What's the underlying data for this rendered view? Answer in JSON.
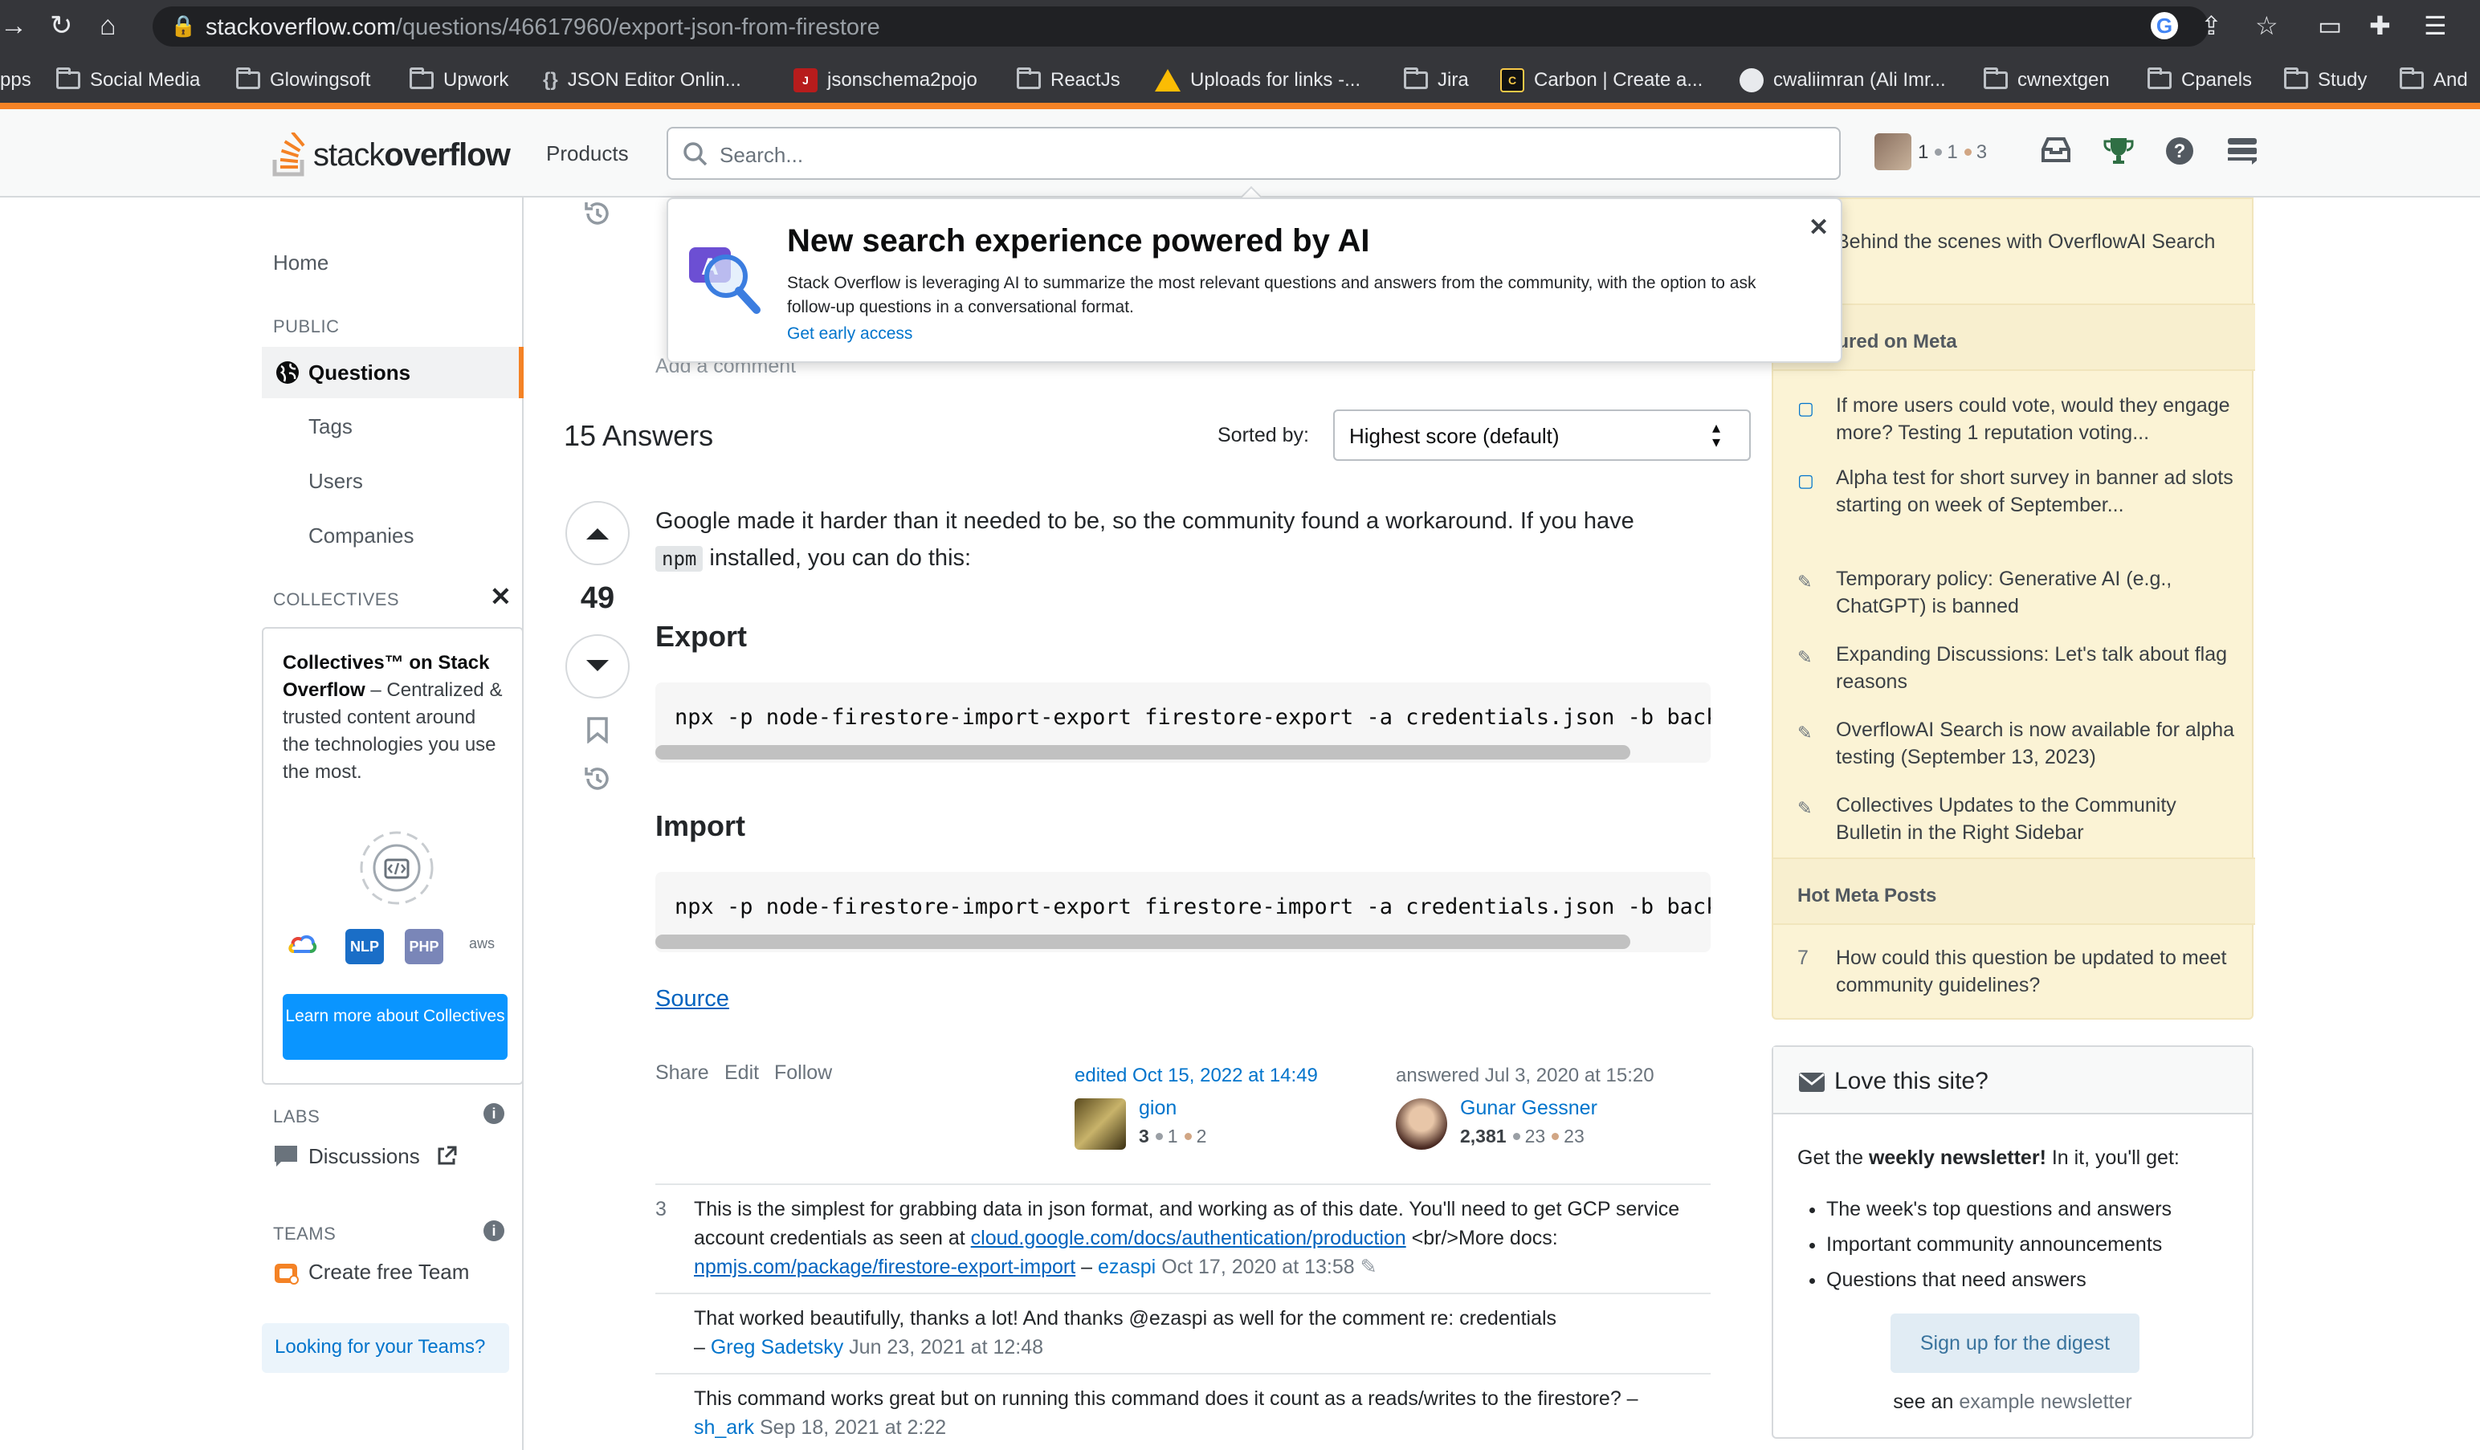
{
  "browser": {
    "url_host": "stackoverflow.com",
    "url_path": "/questions/46617960/export-json-from-firestore",
    "bookmarks": [
      {
        "label": "pps",
        "kind": "text"
      },
      {
        "label": "Social Media",
        "kind": "folder"
      },
      {
        "label": "Glowingsoft",
        "kind": "folder"
      },
      {
        "label": "Upwork",
        "kind": "folder"
      },
      {
        "label": "JSON Editor Onlin...",
        "kind": "braces"
      },
      {
        "label": "jsonschema2pojo",
        "kind": "json"
      },
      {
        "label": "ReactJs",
        "kind": "folder"
      },
      {
        "label": "Uploads for links -...",
        "kind": "drive"
      },
      {
        "label": "Jira",
        "kind": "folder"
      },
      {
        "label": "Carbon | Create a...",
        "kind": "carbon"
      },
      {
        "label": "cwaliimran (Ali Imr...",
        "kind": "github"
      },
      {
        "label": "cwnextgen",
        "kind": "folder"
      },
      {
        "label": "Cpanels",
        "kind": "folder"
      },
      {
        "label": "Study",
        "kind": "folder"
      },
      {
        "label": "And",
        "kind": "folder"
      }
    ]
  },
  "header": {
    "logo_light": "stack",
    "logo_bold": "overflow",
    "products": "Products",
    "search_placeholder": "Search...",
    "rep": "1",
    "silver": "1",
    "bronze": "3",
    "colors": {
      "silver": "#9a9fa5",
      "bronze": "#d1a684",
      "accent": "#f48225"
    }
  },
  "popup": {
    "title": "New search experience powered by AI",
    "body": "Stack Overflow is leveraging AI to summarize the most relevant questions and answers from the community, with the option to ask follow-up questions in a conversational format.",
    "link": "Get early access"
  },
  "leftnav": {
    "home": "Home",
    "public": "PUBLIC",
    "questions": "Questions",
    "tags": "Tags",
    "users": "Users",
    "companies": "Companies",
    "collectives": "COLLECTIVES",
    "collectives_bold": "Collectives™ on Stack Overflow",
    "collectives_desc": " – Centralized & trusted content around the technologies you use the most.",
    "collective_badges": [
      "NLP",
      "PHP",
      "aws"
    ],
    "learn_more": "Learn more about Collectives",
    "labs": "LABS",
    "discussions": "Discussions",
    "teams": "TEAMS",
    "create_team": "Create free Team",
    "looking": "Looking for your Teams?"
  },
  "main": {
    "add_comment": "Add a comment",
    "answers_count": "15 Answers",
    "sorted_by": "Sorted by:",
    "sort_value": "Highest score (default)",
    "answer": {
      "score": "49",
      "text_1": "Google made it harder than it needed to be, so the community found a workaround. If you have",
      "code_inline": "npm",
      "text_2": "installed, you can do this:",
      "export_heading": "Export",
      "export_code": "npx -p node-firestore-import-export firestore-export -a credentials.json -b backup",
      "import_heading": "Import",
      "import_code": "npx -p node-firestore-import-export firestore-import -a credentials.json -b backup",
      "source": "Source",
      "share": "Share",
      "edit": "Edit",
      "follow": "Follow",
      "edited": "edited Oct 15, 2022 at 14:49",
      "editor": {
        "name": "gion",
        "rep": "3",
        "silver": "1",
        "bronze": "2"
      },
      "answered": "answered Jul 3, 2020 at 15:20",
      "author": {
        "name": "Gunar Gessner",
        "rep": "2,381",
        "silver": "23",
        "bronze": "23"
      }
    },
    "comments": [
      {
        "score": "3",
        "text_a": "This is the simplest for grabbing data in json format, and working as of this date. You'll need to get GCP service account credentials as seen at ",
        "link_a": "cloud.google.com/docs/authentication/production",
        "text_b": " <br/>More docs: ",
        "link_b": "npmjs.com/package/firestore-export-import",
        "sep": " – ",
        "user": "ezaspi",
        "date": "Oct 17, 2020 at 13:58"
      },
      {
        "text": "That worked beautifully, thanks a lot! And thanks @ezaspi as well for the comment re: credentials",
        "sep": "– ",
        "user": "Greg Sadetsky",
        "date": "Jun 23, 2021 at 12:48"
      },
      {
        "text": "This command works great but on running this command does it count as a reads/writes to the firestore?",
        "sep": " – ",
        "user": "sh_ark",
        "date": "Sep 18, 2021 at 2:22"
      }
    ]
  },
  "rightbar": {
    "blog_item": "Behind the scenes with OverflowAI Search",
    "featured_head": "Featured on Meta",
    "featured": [
      {
        "icon": "speech-icon",
        "text": "If more users could vote, would they engage more? Testing 1 reputation voting..."
      },
      {
        "icon": "speech-icon",
        "text": "Alpha test for short survey in banner ad slots starting on week of September..."
      },
      {
        "icon": "pencil-icon",
        "text": "Temporary policy: Generative AI (e.g., ChatGPT) is banned"
      },
      {
        "icon": "pencil-icon",
        "text": "Expanding Discussions: Let's talk about flag reasons"
      },
      {
        "icon": "pencil-icon",
        "text": "OverflowAI Search is now available for alpha testing (September 13, 2023)"
      },
      {
        "icon": "pencil-icon",
        "text": "Collectives Updates to the Community Bulletin in the Right Sidebar"
      }
    ],
    "hot_head": "Hot Meta Posts",
    "hot": [
      {
        "count": "7",
        "text": "How could this question be updated to meet community guidelines?"
      }
    ],
    "love_head": "Love this site?",
    "love_intro_a": "Get the ",
    "love_intro_bold": "weekly newsletter!",
    "love_intro_b": " In it, you'll get:",
    "love_bullets": [
      "The week's top questions and answers",
      "Important community announcements",
      "Questions that need answers"
    ],
    "signup": "Sign up for the digest",
    "see_an": "see an ",
    "example": "example newsletter"
  }
}
